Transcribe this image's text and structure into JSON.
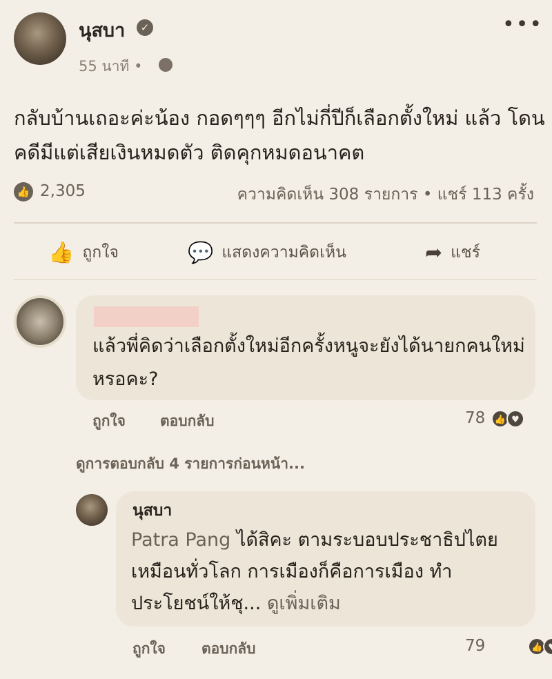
{
  "post": {
    "author": "นุสบา",
    "time": "55 นาที •",
    "text": "กลับบ้านเถอะค่ะน้อง กอดๆๆๆ อีกไม่กี่ปีก็เลือกตั้งใหม่ แล้ว โดนคดีมีแต่เสียเงินหมดตัว ติดคุกหมดอนาคต",
    "likes": "2,305",
    "stats": "ความคิดเห็น 308 รายการ • แชร์ 113 ครั้ง"
  },
  "actions": {
    "like": "ถูกใจ",
    "comment": "แสดงความคิดเห็น",
    "share": "แชร์"
  },
  "comment1": {
    "text": "แล้วพี่คิดว่าเลือกตั้งใหม่อีกครั้งหนูจะยังได้นายกคนใหม่หรอคะ?",
    "like": "ถูกใจ",
    "reply": "ตอบกลับ",
    "count": "78"
  },
  "see_replies": "ดูการตอบกลับ 4 รายการก่อนหน้า...",
  "reply": {
    "author": "นุสบา",
    "mention": "Patra Pang",
    "text": " ได้สิคะ ตามระบอบประชาธิปไตย เหมือนทั่วโลก การเมืองก็คือการเมือง ทำประโยชน์ให้ชุ...",
    "see_more": " ดูเพิ่มเติม",
    "like": "ถูกใจ",
    "reply_label": "ตอบกลับ",
    "count": "79"
  },
  "icons": {
    "more": "more-horizontal-icon",
    "verified": "verified-check-icon",
    "globe": "globe-icon",
    "like": "thumbs-up-icon",
    "comment": "speech-bubble-icon",
    "share": "share-arrow-icon"
  }
}
